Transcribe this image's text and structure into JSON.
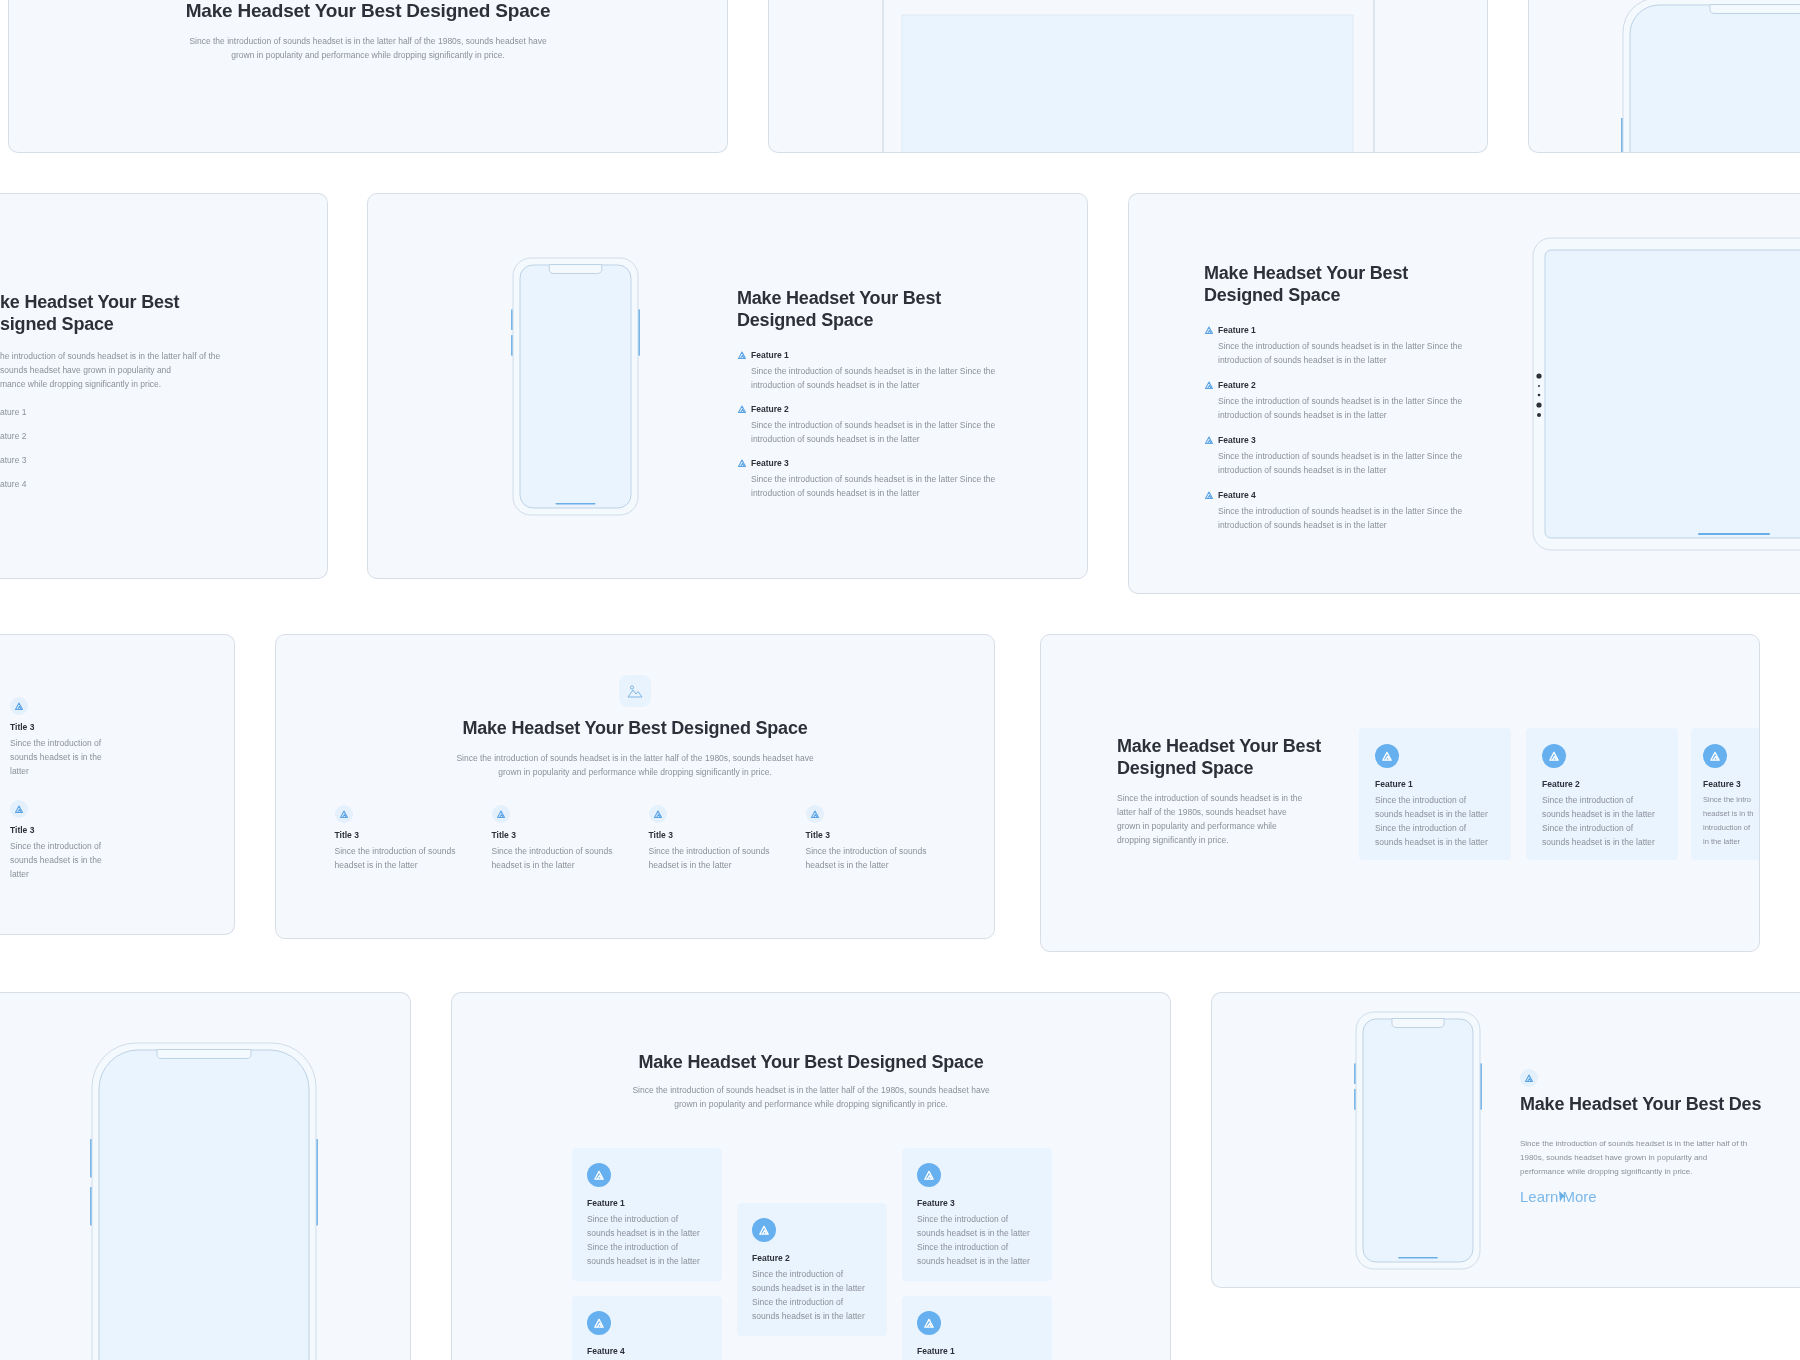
{
  "artboards": [
    {
      "kind": "centered_intro",
      "title": "Make Headset Your Best Designed Space",
      "text": "Since the introduction of sounds headset is in the latter half of the 1980s, sounds headset have grown in popularity and performance while dropping significantly in price."
    },
    {
      "kind": "laptop"
    },
    {
      "kind": "phone_corner"
    },
    {
      "kind": "cut_title_list",
      "title_lines": [
        "ke Headset Your Best",
        "signed Space"
      ],
      "text_lines": [
        "he introduction of sounds headset is in the latter half of the",
        "sounds headset have grown in popularity and",
        "mance while dropping significantly in price."
      ],
      "items": [
        "ature 1",
        "ature 2",
        "ature 3",
        "ature 4"
      ]
    },
    {
      "kind": "phone_features",
      "title": "Make Headset Your Best Designed Space",
      "features": [
        {
          "name": "Feature 1",
          "text": "Since the introduction of sounds headset is in the latter Since the introduction of sounds headset is in the latter"
        },
        {
          "name": "Feature 2",
          "text": "Since the introduction of sounds headset is in the latter Since the introduction of sounds headset is in the latter"
        },
        {
          "name": "Feature 3",
          "text": "Since the introduction of sounds headset is in the latter Since the introduction of sounds headset is in the latter"
        }
      ]
    },
    {
      "kind": "features_tablet",
      "title": "Make Headset Your Best Designed Space",
      "features": [
        {
          "name": "Feature 1",
          "text": "Since the introduction of sounds headset is in the latter Since the introduction of sounds headset is in the latter"
        },
        {
          "name": "Feature 2",
          "text": "Since the introduction of sounds headset is in the latter Since the introduction of sounds headset is in the latter"
        },
        {
          "name": "Feature 3",
          "text": "Since the introduction of sounds headset is in the latter Since the introduction of sounds headset is in the latter"
        },
        {
          "name": "Feature 4",
          "text": "Since the introduction of sounds headset is in the latter Since the introduction of sounds headset is in the latter"
        }
      ]
    },
    {
      "kind": "title_list",
      "items": [
        {
          "title": "Title 3",
          "text": "Since the introduction of sounds headset is in the latter"
        },
        {
          "title": "Title 3",
          "text": "Since the introduction of sounds headset is in the latter"
        }
      ]
    },
    {
      "kind": "centered_columns",
      "title": "Make Headset Your Best Designed Space",
      "text": "Since the introduction of sounds headset is in the latter half of the 1980s, sounds headset have grown in popularity and performance while dropping significantly in price.",
      "columns": [
        {
          "title": "Title 3",
          "text": "Since the introduction of sounds headset is in the latter"
        },
        {
          "title": "Title 3",
          "text": "Since the introduction of sounds headset is in the latter"
        },
        {
          "title": "Title 3",
          "text": "Since the introduction of sounds headset is in the latter"
        },
        {
          "title": "Title 3",
          "text": "Since the introduction of sounds headset is in the latter"
        }
      ]
    },
    {
      "kind": "side_cards",
      "title": "Make Headset Your Best Designed Space",
      "text": "Since the introduction of sounds headset is in the latter half of the 1980s, sounds headset have grown in popularity and performance while dropping significantly in price.",
      "cards": [
        {
          "title": "Feature 1",
          "text": "Since the introduction of sounds headset is in the latter Since the introduction of sounds headset is in the latter"
        },
        {
          "title": "Feature 2",
          "text": "Since the introduction of sounds headset is in the latter Since the introduction of sounds headset is in the latter"
        },
        {
          "title": "Feature 3",
          "lines": [
            "Since the intro",
            "headset is in th",
            "introduction of",
            "in the latter"
          ]
        }
      ]
    },
    {
      "kind": "phone_full"
    },
    {
      "kind": "staggered_cards",
      "title": "Make Headset Your Best Designed Space",
      "text": "Since the introduction of sounds headset is in the latter half of the 1980s, sounds headset have grown in popularity and performance while dropping significantly in price.",
      "cards": [
        {
          "title": "Feature 1",
          "text": "Since the introduction of sounds headset is in the latter Since the introduction of sounds headset is in the latter"
        },
        {
          "title": "Feature 2",
          "text": "Since the introduction of sounds headset is in the latter Since the introduction of sounds headset is in the latter"
        },
        {
          "title": "Feature 3",
          "text": "Since the introduction of sounds headset is in the latter Since the introduction of sounds headset is in the latter"
        },
        {
          "title": "Feature 4"
        },
        {
          "title": "Feature 1"
        }
      ]
    },
    {
      "kind": "phone_link",
      "title": "Make Headset Your Best Des",
      "text_lines": [
        "Since the introduction of sounds headset is in the latter half of th",
        "1980s, sounds headset have grown in popularity and",
        "performance while dropping significantly in price."
      ],
      "link": "Learn More"
    }
  ]
}
